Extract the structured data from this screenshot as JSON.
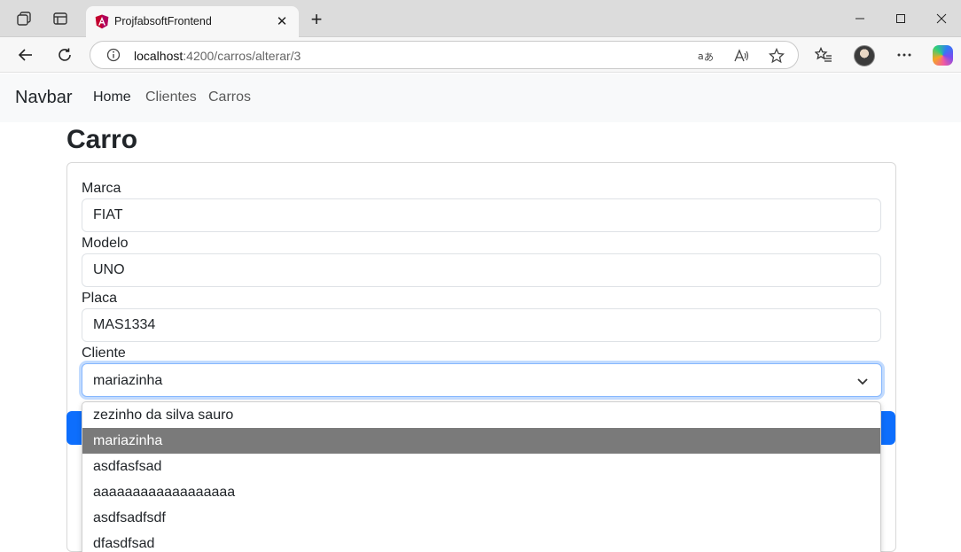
{
  "browser": {
    "tab_title": "ProjfabsoftFrontend",
    "url_host": "localhost",
    "url_path": ":4200/carros/alterar/3",
    "icons": [
      "workspaces-icon",
      "vertical-tabs-icon",
      "angular-favicon",
      "close-icon",
      "new-tab-icon",
      "minimize-icon",
      "maximize-icon",
      "window-close-icon",
      "back-icon",
      "refresh-icon",
      "site-info-icon",
      "translate-icon",
      "read-aloud-icon",
      "favorite-star-icon",
      "favorites-icon",
      "profile-avatar",
      "more-icon",
      "copilot-icon"
    ]
  },
  "navbar": {
    "brand": "Navbar",
    "links": [
      {
        "label": "Home",
        "active": true
      },
      {
        "label": "Clientes",
        "active": false
      },
      {
        "label": "Carros",
        "active": false
      }
    ]
  },
  "form": {
    "title": "Carro",
    "marca_label": "Marca",
    "marca_value": "FIAT",
    "modelo_label": "Modelo",
    "modelo_value": "UNO",
    "placa_label": "Placa",
    "placa_value": "MAS1334",
    "cliente_label": "Cliente",
    "cliente_value": "mariazinha"
  },
  "dropdown": {
    "options": [
      "zezinho da silva sauro",
      "mariazinha",
      "asdfasfsad",
      "aaaaaaaaaaaaaaaaaa",
      "asdfsadfsdf",
      "dfasdfsad"
    ],
    "selected_index": 1
  },
  "colors": {
    "primary": "#0d6efd",
    "focus_border": "#86b7fe",
    "selected_option": "#7a7a7a"
  }
}
